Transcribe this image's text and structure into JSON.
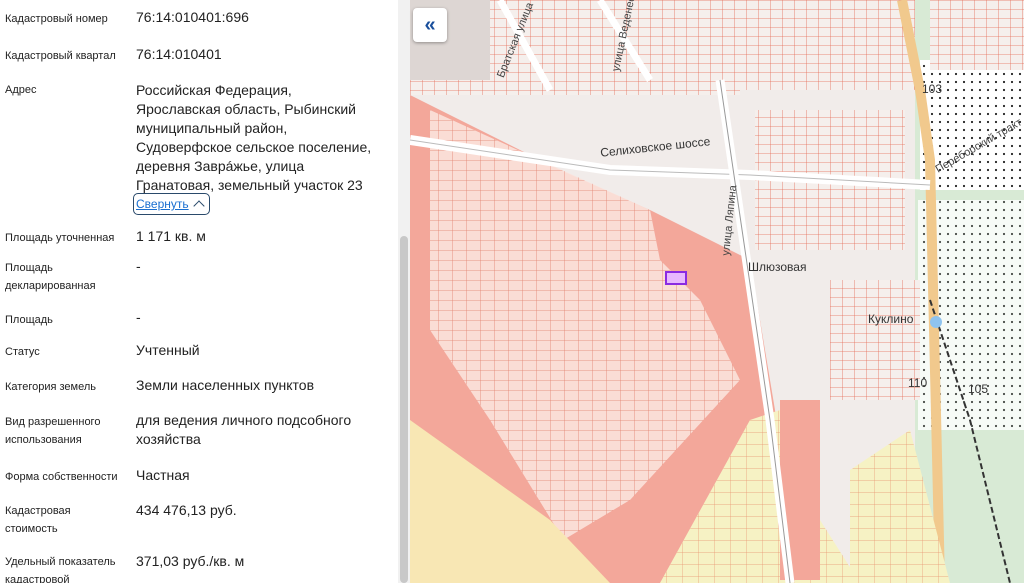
{
  "details": [
    {
      "label": "Кадастровый номер",
      "value": "76:14:010401:696"
    },
    {
      "label": "Кадастровый квартал",
      "value": "76:14:010401"
    },
    {
      "label": "Адрес",
      "value": "Российская Федерация,\nЯрославская область, Рыбинский\nмуниципальный район,\nСудоверфское сельское поселение,\nдеревня Заврáжье, улица\nГранатовая, земельный участок 23"
    },
    {
      "label": "Площадь уточненная",
      "value": "1 171 кв. м"
    },
    {
      "label": "Площадь\nдекларированная",
      "value": "-"
    },
    {
      "label": "Площадь",
      "value": "-"
    },
    {
      "label": "Статус",
      "value": "Учтенный"
    },
    {
      "label": "Категория земель",
      "value": "Земли населенных пунктов"
    },
    {
      "label": "Вид разрешенного\nиспользования",
      "value": "для ведения личного подсобного\nхозяйства"
    },
    {
      "label": "Форма собственности",
      "value": "Частная"
    },
    {
      "label": "Кадастровая\nстоимость",
      "value": "434 476,13 руб."
    },
    {
      "label": "Удельный показатель\nкадастровой",
      "value": "371,03 руб./кв. м"
    }
  ],
  "collapse_label": "Свернуть",
  "map": {
    "back_icon": "double-chevron-left-icon",
    "labels": {
      "road1": "Селиховское шоссе",
      "street1": "Братская улица",
      "street2": "улица Веденеева",
      "street3": "улица Ляпина",
      "street4": "Шлюзовая",
      "place1": "Куклино",
      "num1": "103",
      "num2": "105",
      "num3": "110",
      "road2": "Переборский тракт"
    }
  }
}
